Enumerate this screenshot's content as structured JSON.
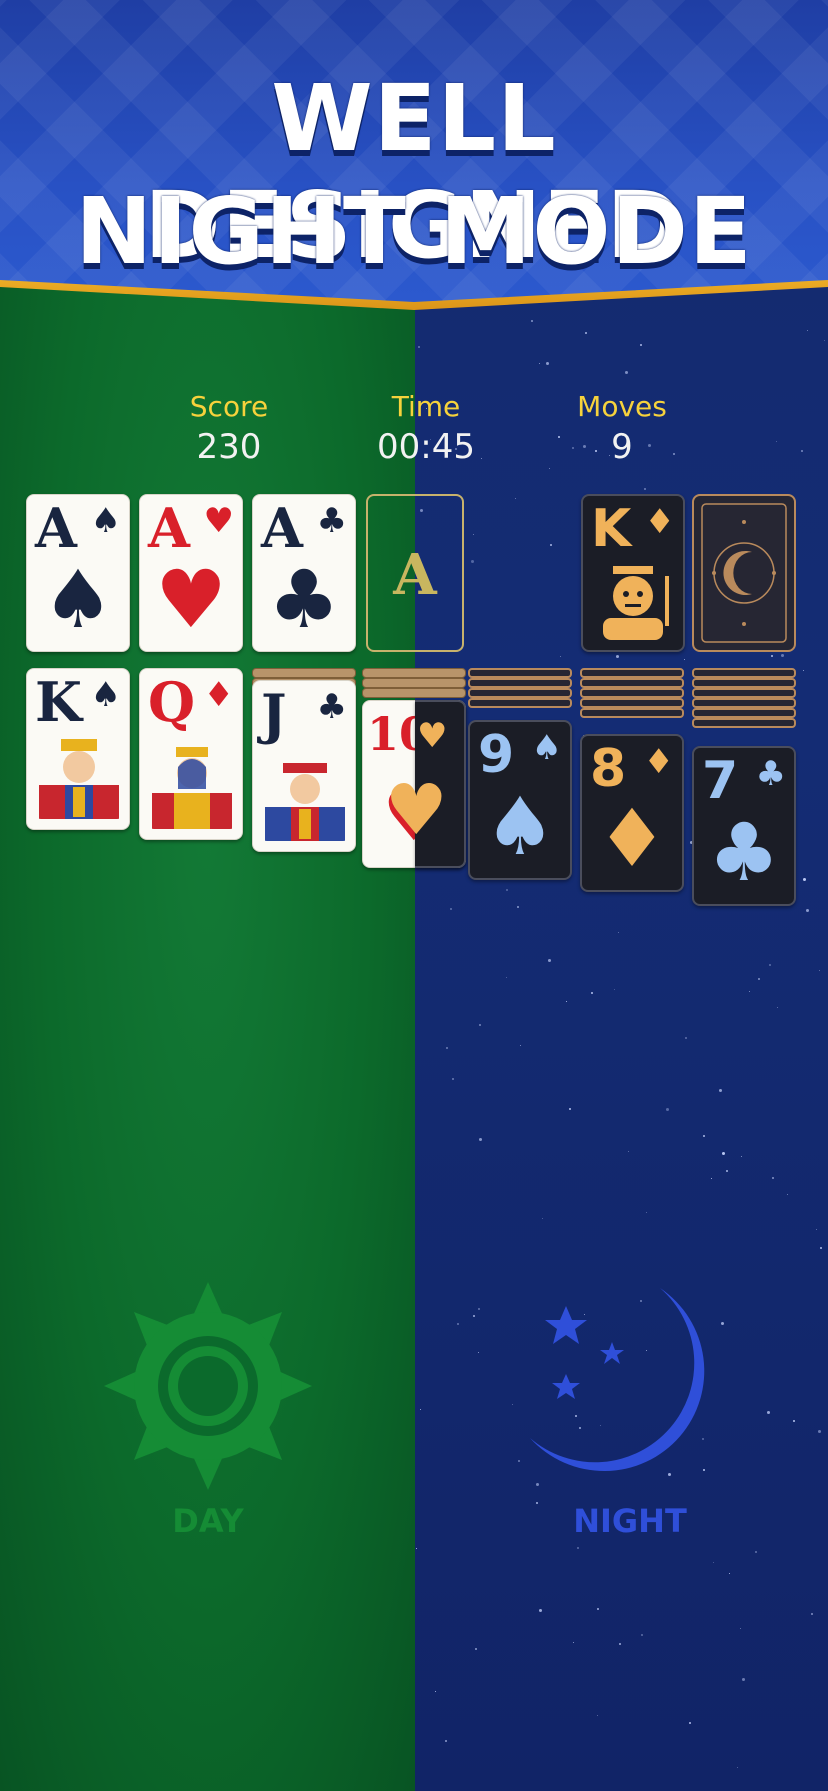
{
  "banner": {
    "line1": "WELL DESIGNED",
    "line2": "NIGHT MODE"
  },
  "stats": {
    "score_label": "Score",
    "score_value": "230",
    "time_label": "Time",
    "time_value": "00:45",
    "moves_label": "Moves",
    "moves_value": "9"
  },
  "foundation": [
    {
      "rank": "A",
      "suit": "♠"
    },
    {
      "rank": "A",
      "suit": "♥"
    },
    {
      "rank": "A",
      "suit": "♣"
    },
    {
      "rank": "A",
      "suit": ""
    }
  ],
  "waste": {
    "rank": "K",
    "suit": "♦"
  },
  "tableau": [
    {
      "rank": "K",
      "suit": "♠"
    },
    {
      "rank": "Q",
      "suit": "♦"
    },
    {
      "rank": "J",
      "suit": "♣"
    },
    {
      "rank": "10",
      "suit": "♥"
    },
    {
      "rank": "9",
      "suit": "♠"
    },
    {
      "rank": "8",
      "suit": "♦"
    },
    {
      "rank": "7",
      "suit": "♣"
    }
  ],
  "modes": {
    "day_label": "DAY",
    "night_label": "NIGHT",
    "day_icon": "sun-icon",
    "night_icon": "moon-icon"
  },
  "colors": {
    "day_bg": "#0c6a2b",
    "night_bg": "#142a6e",
    "banner_bg": "#2851c4",
    "accent_gold": "#f6d23c",
    "night_accent": "#2f4fd9"
  }
}
